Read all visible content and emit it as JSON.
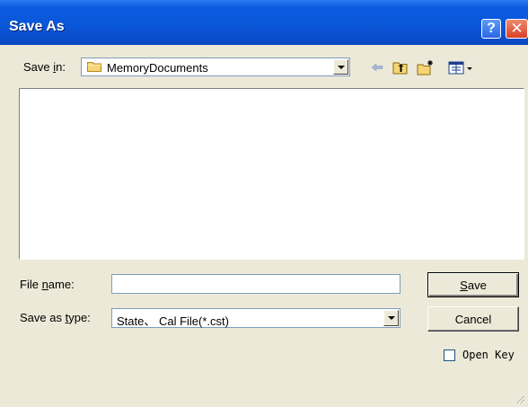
{
  "window": {
    "title": "Save As"
  },
  "titlebar_buttons": {
    "help": "?",
    "close": "✕"
  },
  "save_in": {
    "label_prefix": "Save ",
    "label_accel": "i",
    "label_suffix": "n:",
    "value": "MemoryDocuments",
    "icon": "folder-icon"
  },
  "toolbar": {
    "back_icon": "back-arrow-icon",
    "up_icon": "up-one-level-icon",
    "new_folder_icon": "new-folder-icon",
    "views_icon": "view-menu-icon"
  },
  "file_name": {
    "label_prefix": "File ",
    "label_accel": "n",
    "label_suffix": "ame:",
    "value": ""
  },
  "save_as_type": {
    "label_prefix": "Save as ",
    "label_accel": "t",
    "label_suffix": "ype:",
    "value": "State、 Cal File(*.cst)"
  },
  "buttons": {
    "save_accel": "S",
    "save_rest": "ave",
    "cancel": "Cancel"
  },
  "open_key": {
    "label": "Open Key",
    "checked": false
  },
  "colors": {
    "titlebar": "#0a56d8",
    "dialog_bg": "#ece9d8",
    "close": "#d8402a"
  }
}
